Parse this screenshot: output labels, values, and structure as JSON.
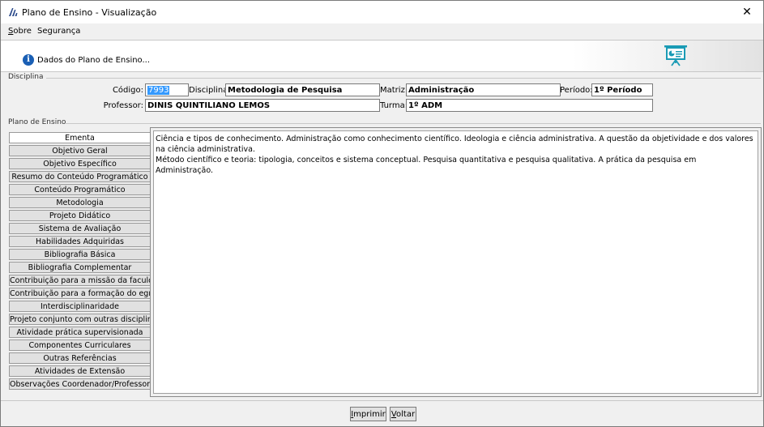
{
  "window": {
    "title": "Plano de Ensino - Visualização",
    "close_glyph": "✕"
  },
  "menu": [
    {
      "first": "S",
      "rest": "obre"
    },
    {
      "first": "",
      "rest": "Segurança"
    }
  ],
  "header": {
    "text": "Dados do Plano de Ensino..."
  },
  "disciplina": {
    "group_label": "Disciplina",
    "codigo_label": "Código:",
    "codigo_value": "7993",
    "disciplina_label": "Disciplina:",
    "disciplina_value": "Metodologia de Pesquisa",
    "matriz_label": "Matriz:",
    "matriz_value": "Administração",
    "periodo_label": "Período:",
    "periodo_value": "1º Período",
    "professor_label": "Professor:",
    "professor_value": "DINIS QUINTILIANO LEMOS",
    "turma_label": "Turma:",
    "turma_value": "1º ADM"
  },
  "plano": {
    "group_label": "Plano de Ensino",
    "tabs": [
      "Ementa",
      "Objetivo Geral",
      "Objetivo Específico",
      "Resumo do Conteúdo Programático",
      "Conteúdo Programático",
      "Metodologia",
      "Projeto Didático",
      "Sistema de Avaliação",
      "Habilidades Adquiridas",
      "Bibliografia Básica",
      "Bibliografia Complementar",
      "Contribuição para a missão da faculdade",
      "Contribuição para a formação do egresso",
      "Interdisciplinaridade",
      "Projeto conjunto com outras disciplinas",
      "Atividade prática supervisionada",
      "Componentes Curriculares",
      "Outras Referências",
      "Atividades de Extensão",
      "Observações Coordenador/Professor"
    ],
    "active_tab": 0,
    "content_lines": [
      "Ciência e tipos de conhecimento. Administração como conhecimento científico. Ideologia e ciência administrativa. A questão da objetividade e dos valores na ciência administrativa.",
      "Método científico e teoria: tipologia, conceitos e sistema conceptual. Pesquisa quantitativa e pesquisa qualitativa. A prática da pesquisa em Administração."
    ]
  },
  "buttons": {
    "imprimir": {
      "first": "I",
      "rest": "mprimir"
    },
    "voltar": {
      "first": "V",
      "rest": "oltar"
    }
  },
  "colors": {
    "selection": "#3399ff",
    "info_icon": "#1a5fb4",
    "board_icon": "#1a9bb5"
  }
}
